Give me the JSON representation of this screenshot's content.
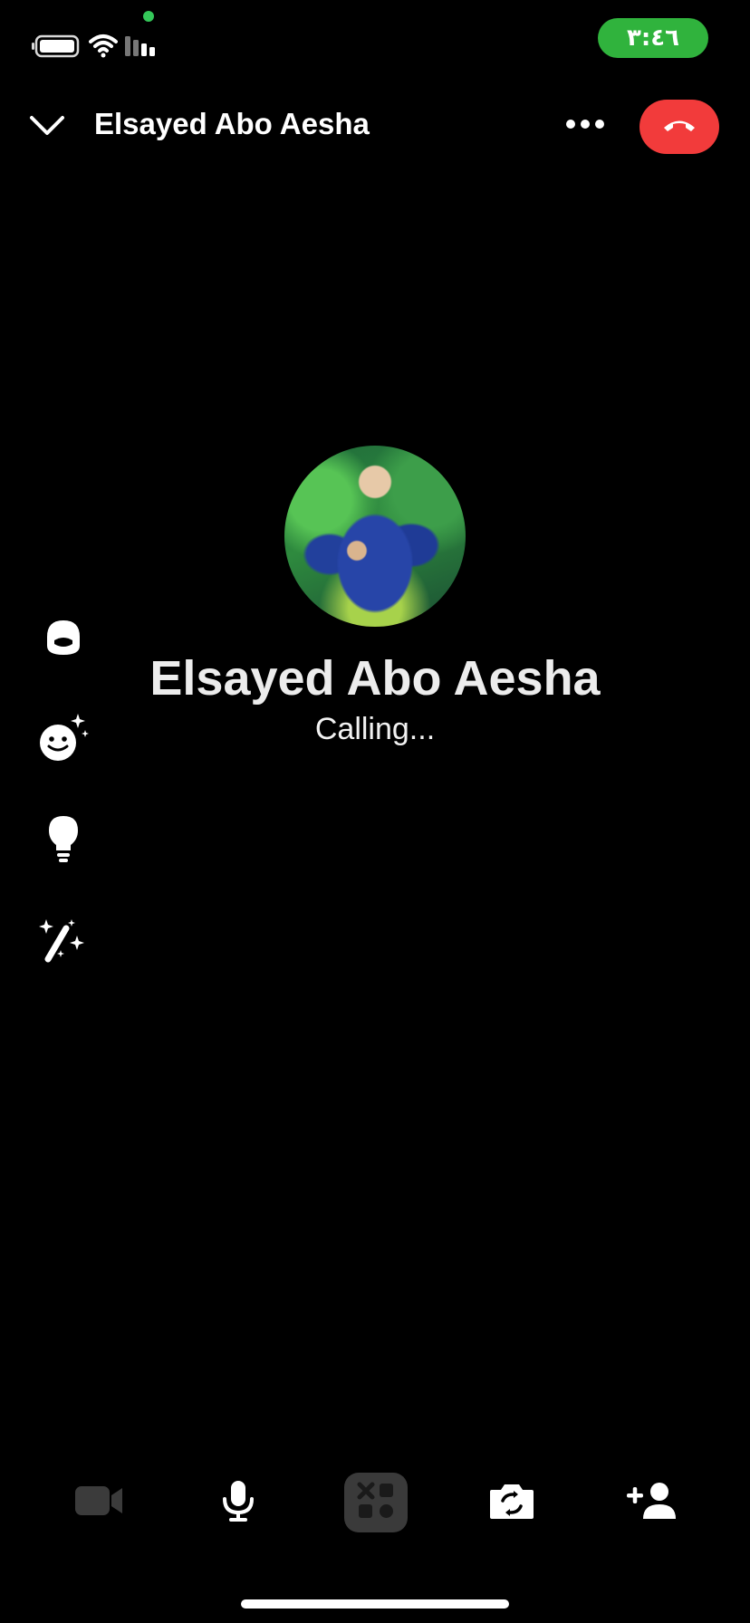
{
  "status_bar": {
    "time": "٣:٤٦",
    "icons": [
      "battery-icon",
      "wifi-icon",
      "signal-icon",
      "microphone-indicator-dot"
    ],
    "colors": {
      "clock_pill": "#30b33d",
      "mic_dot": "#34c759"
    }
  },
  "header": {
    "title": "Elsayed Abo Aesha",
    "icons": [
      "chevron-down-icon",
      "more-icon",
      "end-call-icon"
    ],
    "colors": {
      "end_call": "#f23b3b"
    }
  },
  "caller": {
    "name": "Elsayed Abo Aesha",
    "status": "Calling..."
  },
  "side_effects": [
    "avatar-icon",
    "sparkle-face-icon",
    "lightbulb-icon",
    "magic-wand-icon"
  ],
  "toolbar": [
    "video-camera-icon",
    "microphone-icon",
    "effects-grid-icon",
    "flip-camera-icon",
    "add-person-icon"
  ]
}
